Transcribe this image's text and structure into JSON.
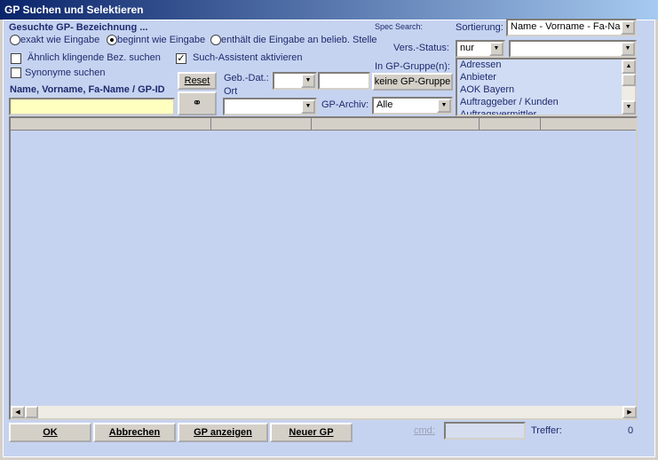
{
  "window": {
    "title": "GP Suchen und Selektieren"
  },
  "search": {
    "heading": "Gesuchte GP- Bezeichnung ...",
    "radio_options": [
      "exakt wie Eingabe",
      "beginnt wie Eingabe",
      "enthält die Eingabe an belieb. Stelle"
    ],
    "radio_selected": "beginnt wie Eingabe",
    "check_similar": "Ähnlich klingende Bez. suchen",
    "check_similar_checked": false,
    "check_synonyms": "Synonyme suchen",
    "check_synonyms_checked": false,
    "check_assistant": "Such-Assistent aktivieren",
    "check_assistant_checked": true,
    "name_label": "Name, Vorname, Fa-Name / GP-ID",
    "name_value": "",
    "reset_label": "Reset"
  },
  "filters": {
    "geb_label": "Geb.-Dat.:",
    "ort_label": "Ort",
    "gp_archiv_label": "GP-Archiv:",
    "gp_archiv_value": "Alle",
    "spec_search_label": "Spec Search:",
    "sortierung_label": "Sortierung:",
    "sortierung_value": "Name - Vorname - Fa-Name",
    "vers_status_label": "Vers.-Status:",
    "vers_status_value": "nur",
    "gp_gruppe_label": "In GP-Gruppe(n):",
    "keine_gruppe_label": "keine GP-Gruppe",
    "gruppen": [
      "Adressen",
      "Anbieter",
      "AOK Bayern",
      "Auftraggeber / Kunden",
      "Auftragsvermittler"
    ]
  },
  "footer": {
    "ok_label": "OK",
    "cancel_label": "Abbrechen",
    "show_label": "GP anzeigen",
    "new_label": "Neuer GP",
    "cmd_label": "cmd:",
    "treffer_label": "Treffer:",
    "treffer_value": "0"
  },
  "icons": {
    "search": "binoculars-icon",
    "dropdown": "chevron-down-icon"
  }
}
